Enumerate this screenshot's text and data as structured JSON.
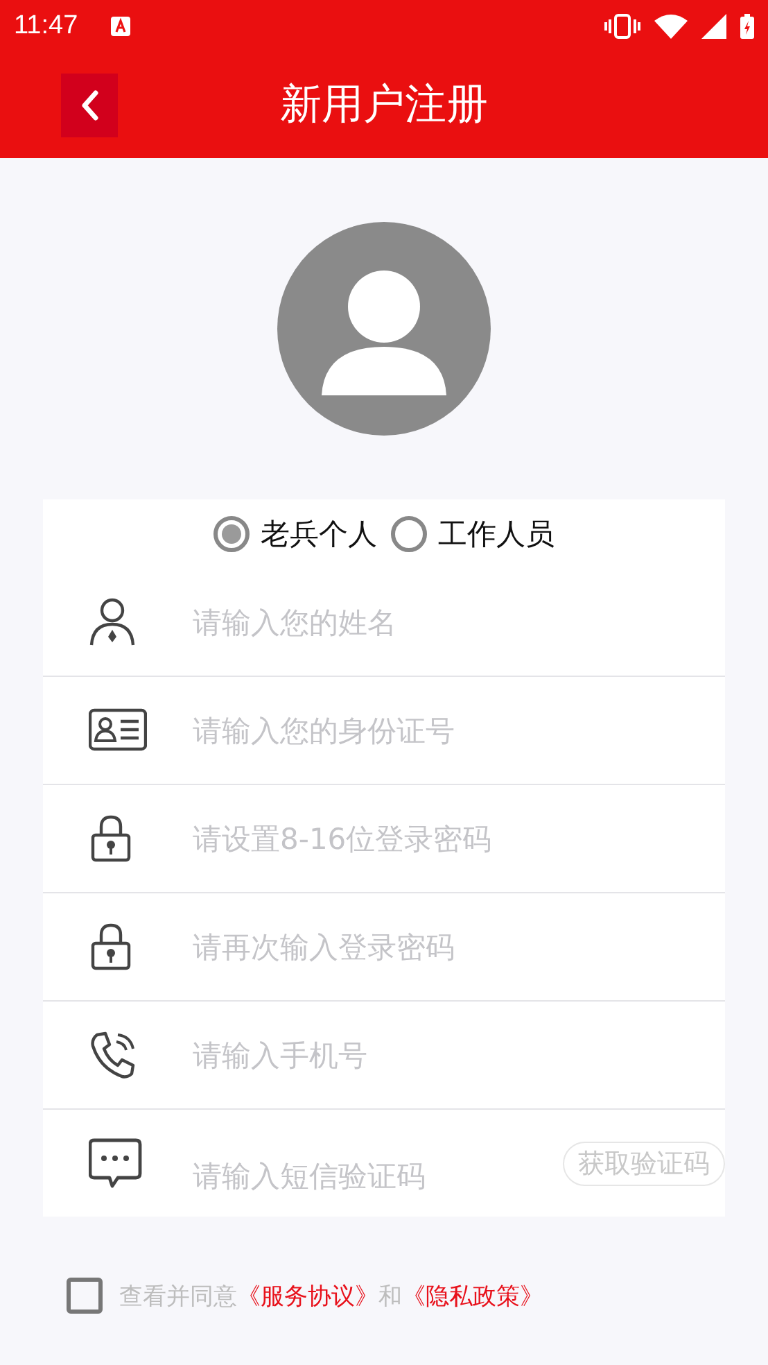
{
  "status_bar": {
    "time": "11:47"
  },
  "header": {
    "title": "新用户注册"
  },
  "user_type": [
    {
      "label": "老兵个人",
      "selected": true
    },
    {
      "label": "工作人员",
      "selected": false
    }
  ],
  "fields": [
    {
      "kind": "person",
      "placeholder": "请输入您的姓名"
    },
    {
      "kind": "id-card",
      "placeholder": "请输入您的身份证号"
    },
    {
      "kind": "lock",
      "placeholder": "请设置8-16位登录密码"
    },
    {
      "kind": "lock",
      "placeholder": "请再次输入登录密码"
    },
    {
      "kind": "phone",
      "placeholder": "请输入手机号"
    },
    {
      "kind": "message",
      "placeholder": "请输入短信验证码",
      "button": "获取验证码"
    }
  ],
  "agreement": {
    "checked": false,
    "text": "查看并同意",
    "link1": "《服务协议》",
    "joiner": "和",
    "link2": "《隐私政策》"
  }
}
